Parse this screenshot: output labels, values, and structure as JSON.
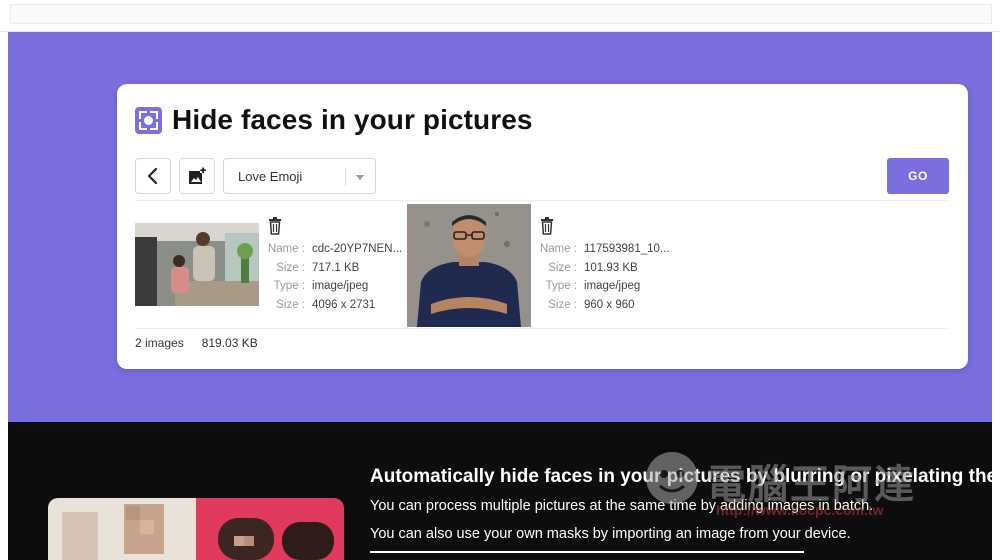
{
  "card": {
    "title": "Hide faces in your pictures",
    "mask_select": {
      "value": "Love Emoji"
    },
    "go_label": "GO"
  },
  "images": [
    {
      "name_label": "Name :",
      "name": "cdc-20YP7NEN...",
      "size_label": "Size :",
      "file_size": "717.1 KB",
      "type_label": "Type :",
      "type": "image/jpeg",
      "dim_label": "Size :",
      "dimensions": "4096 x 2731"
    },
    {
      "name_label": "Name :",
      "name": "117593981_10...",
      "size_label": "Size :",
      "file_size": "101.93 KB",
      "type_label": "Type :",
      "type": "image/jpeg",
      "dim_label": "Size :",
      "dimensions": "960 x 960"
    }
  ],
  "summary": {
    "count": "2 images",
    "total_size": "819.03 KB"
  },
  "lower": {
    "heading": "Automatically hide faces in your pictures by blurring or pixelating them.",
    "line1": "You can process multiple pictures at the same time by adding images in batch.",
    "line2": "You can also use your own masks by importing an image from your device."
  },
  "watermark": {
    "text": "電腦王阿達",
    "url": "http://www.kocpc.com.tw"
  },
  "colors": {
    "accent": "#7b6fe0",
    "dark_section": "#0d0d0f"
  },
  "icons": [
    "face-detect-logo-icon",
    "chevron-left-icon",
    "add-image-icon",
    "caret-down-icon",
    "trash-icon"
  ]
}
